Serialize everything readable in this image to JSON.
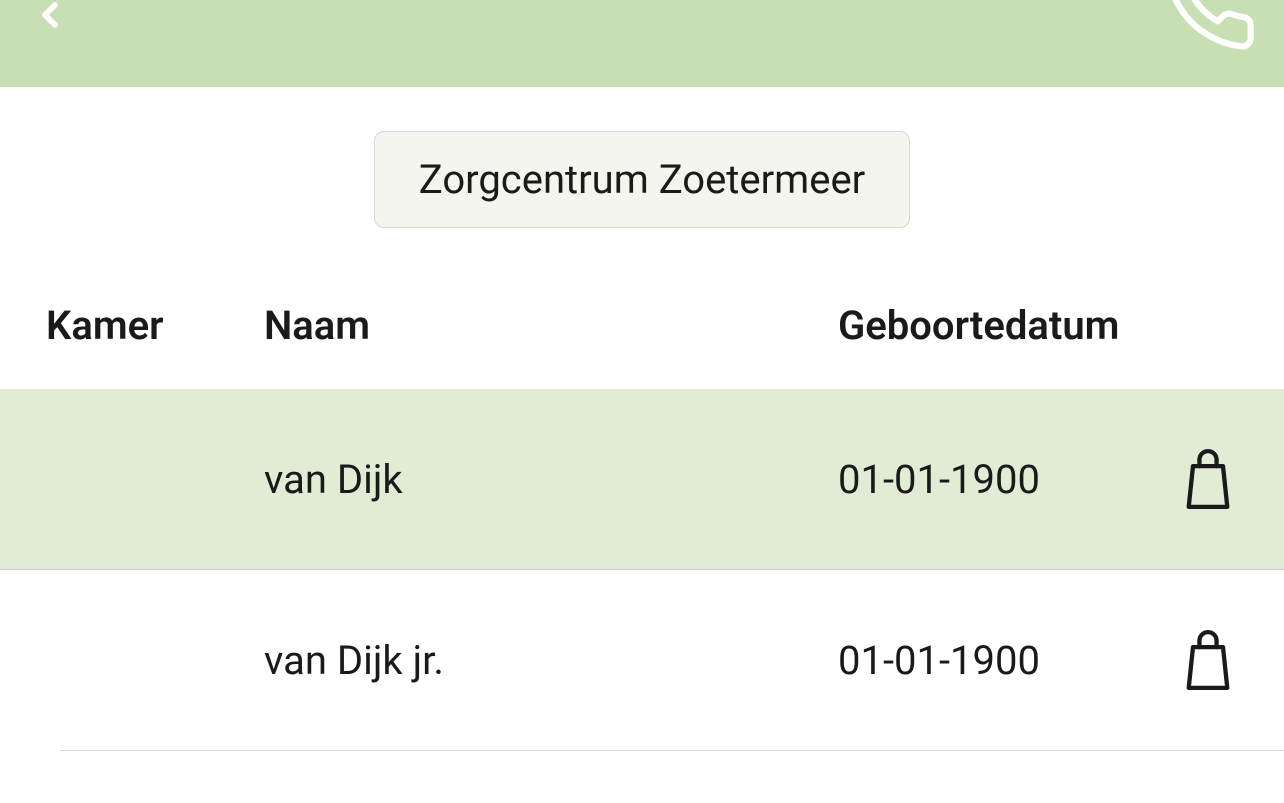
{
  "location": {
    "name": "Zorgcentrum Zoetermeer"
  },
  "table": {
    "headers": {
      "kamer": "Kamer",
      "naam": "Naam",
      "geboortedatum": "Geboortedatum"
    },
    "rows": [
      {
        "kamer": "",
        "naam": "van Dijk",
        "geboortedatum": "01-01-1900",
        "highlighted": true
      },
      {
        "kamer": "",
        "naam": "van Dijk jr.",
        "geboortedatum": "01-01-1900",
        "highlighted": false
      }
    ]
  }
}
